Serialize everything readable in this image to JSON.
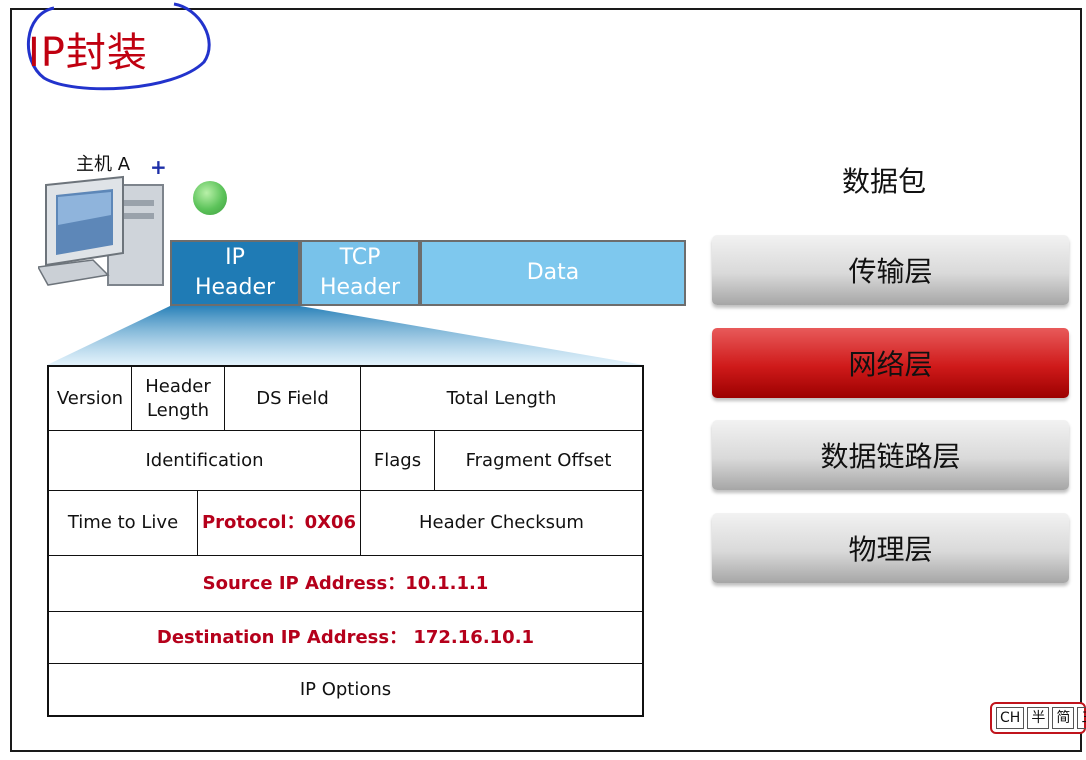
{
  "title": "IP封装",
  "host": {
    "label": "主机 A",
    "plus": "+"
  },
  "packet": {
    "ip_line1": "IP",
    "ip_line2": "Header",
    "tcp_line1": "TCP",
    "tcp_line2": "Header",
    "data": "Data"
  },
  "header": {
    "version": "Version",
    "header_length_1": "Header",
    "header_length_2": "Length",
    "ds_field": "DS Field",
    "total_length": "Total Length",
    "identification": "Identification",
    "flags": "Flags",
    "fragment_offset": "Fragment Offset",
    "ttl": "Time to Live",
    "protocol": "Protocol：0X06",
    "checksum": "Header Checksum",
    "source": "Source IP Address：10.1.1.1",
    "destination": "Destination IP Address： 172.16.10.1",
    "options": "IP  Options"
  },
  "layers": {
    "packet_label": "数据包",
    "transport": "传输层",
    "network": "网络层",
    "datalink": "数据链路层",
    "physical": "物理层"
  },
  "ime": {
    "mode": "CH",
    "half": "半",
    "simple": "简",
    "menu": "三"
  },
  "colors": {
    "title": "#c00010",
    "ip_header": "#1f7bb5",
    "tcp_header": "#78c2ea",
    "data": "#7ec8ee",
    "highlight_red": "#b5001b",
    "network_layer": "#cf1a1a"
  }
}
